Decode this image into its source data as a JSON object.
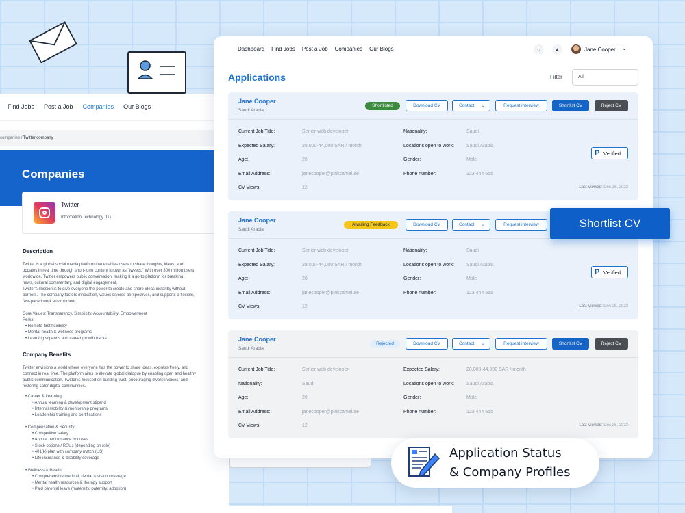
{
  "back_page": {
    "nav": [
      "Find Jobs",
      "Post a Job",
      "Companies",
      "Our Blogs"
    ],
    "breadcrumb": [
      "companies",
      "/",
      "Twitter company"
    ],
    "hero_title": "Companies",
    "company": {
      "name": "Twitter",
      "industry": "Information Technology (IT)"
    },
    "description_title": "Description",
    "description": [
      "Twitter is a global social media platform that enables users to share thoughts, ideas, and",
      "updates in real time through short-form content known as \"tweets.\" With over 300 million users",
      "worldwide, Twitter empowers public conversation, making it a go-to platform for breaking",
      "news, cultural commentary, and digital engagement.",
      "Twitter's mission is to give everyone the power to create and share ideas instantly without",
      "barriers. The company fosters innovation, values diverse perspectives, and supports a flexible,",
      "fast-paced work environment."
    ],
    "core_values": "Core Values: Transparency, Simplicity, Accountability, Empowerment",
    "perks_label": "Perks:",
    "perks": [
      "Remote-first flexibility",
      "Mental health & wellness programs",
      "Learning stipends and career growth tracks"
    ],
    "benefits_title": "Company Benefits",
    "benefits_intro": [
      "Twitter envisions a world where everyone has the power to share ideas, express freely, and",
      "connect in real time. The platform aims to elevate global dialogue by enabling open and healthy",
      "public communication. Twitter is focused on building trust, encouraging diverse voices, and",
      "fostering safer digital communities."
    ],
    "benefit_groups": [
      {
        "title": "Career & Learning",
        "items": [
          "Annual learning & development stipend",
          "Internal mobility & mentorship programs",
          "Leadership training and certifications"
        ]
      },
      {
        "title": "Compensation & Security",
        "items": [
          "Competitive salary",
          "Annual performance bonuses",
          "Stock options / RSUs (depending on role)",
          "401(k) plan with company match (US)",
          "Life insurance & disability coverage"
        ]
      },
      {
        "title": "Wellness & Health",
        "items": [
          "Comprehensive medical, dental & vision coverage",
          "Mental health resources & therapy support",
          "Paid parental leave (maternity, paternity, adoption)"
        ]
      }
    ]
  },
  "panel": {
    "nav": [
      "Dashboard",
      "Find Jobs",
      "Post a Job",
      "Companies",
      "Our Blogs"
    ],
    "user_name": "Jane Cooper",
    "title": "Applications",
    "filter_label": "Filter",
    "filter_value": "All",
    "buttons": {
      "download": "Download CV",
      "contact": "Contact",
      "request": "Request interview",
      "shortlist": "Shortlist CV",
      "reject": "Reject CV"
    },
    "verified_label": "Verified",
    "last_viewed_label": "Last Viewed:",
    "applications": [
      {
        "name": "Jane Cooper",
        "location": "Saudi Arabia",
        "status": "Shortlisted",
        "last_viewed": "Dec 26, 2023",
        "fields": {
          "job_title_label": "Current Job Title:",
          "job_title": "Senior web developer",
          "salary_label": "Expected Salary:",
          "salary": "28,000-44,000 SAR / month",
          "age_label": "Age:",
          "age": "26",
          "email_label": "Email Address:",
          "email": "janecooper@pinkcamel.ae",
          "views_label": "CV Views:",
          "views": "12",
          "nationality_label": "Nationality:",
          "nationality": "Saudi",
          "locations_label": "Locations open to work:",
          "locations": "Saudi Arabia",
          "gender_label": "Gender:",
          "gender": "Male",
          "phone_label": "Phone number:",
          "phone": "123 444 555"
        }
      },
      {
        "name": "Jane Cooper",
        "location": "Saudi Arabia",
        "status": "Awaiting Feedback",
        "last_viewed": "Dec 26, 2023",
        "fields": {
          "job_title_label": "Current Job Title:",
          "job_title": "Senior web developer",
          "salary_label": "Expected Salary:",
          "salary": "28,000-44,000 SAR / month",
          "age_label": "Age:",
          "age": "26",
          "email_label": "Email Address:",
          "email": "janecooper@pinkcamel.ae",
          "views_label": "CV Views:",
          "views": "12",
          "nationality_label": "Nationality:",
          "nationality": "Saudi",
          "locations_label": "Locations open to work:",
          "locations": "Saudi Arabia",
          "gender_label": "Gender:",
          "gender": "Male",
          "phone_label": "Phone number:",
          "phone": "123 444 555"
        }
      },
      {
        "name": "Jane Cooper",
        "location": "Saudi Arabia",
        "status": "Rejected",
        "last_viewed": "Dec 26, 2023",
        "fields": {
          "job_title_label": "Current Job Title:",
          "job_title": "Senior web developer",
          "salary_label": "Expected Salary:",
          "salary": "28,000-44,000 SAR / month",
          "nationality_label": "Nationality:",
          "nationality": "Saudi",
          "locations_label": "Locations open to work:",
          "locations": "Saudi Arabia",
          "age_label": "Age:",
          "age": "26",
          "gender_label": "Gender:",
          "gender": "Male",
          "email_label": "Email Address:",
          "email": "janecooper@pinkcamel.ae",
          "phone_label": "Phone number:",
          "phone": "123 444 555",
          "views_label": "CV Views:",
          "views": "12"
        }
      }
    ]
  },
  "shortlist_callout": "Shortlist CV",
  "feature": {
    "line1": "Application Status",
    "line2": "& Company Profiles"
  },
  "colors": {
    "brand_blue": "#1664c6",
    "shortlisted": "#3b8a3e",
    "awaiting": "#f5c518",
    "rejected_bg": "#e3eefb"
  }
}
